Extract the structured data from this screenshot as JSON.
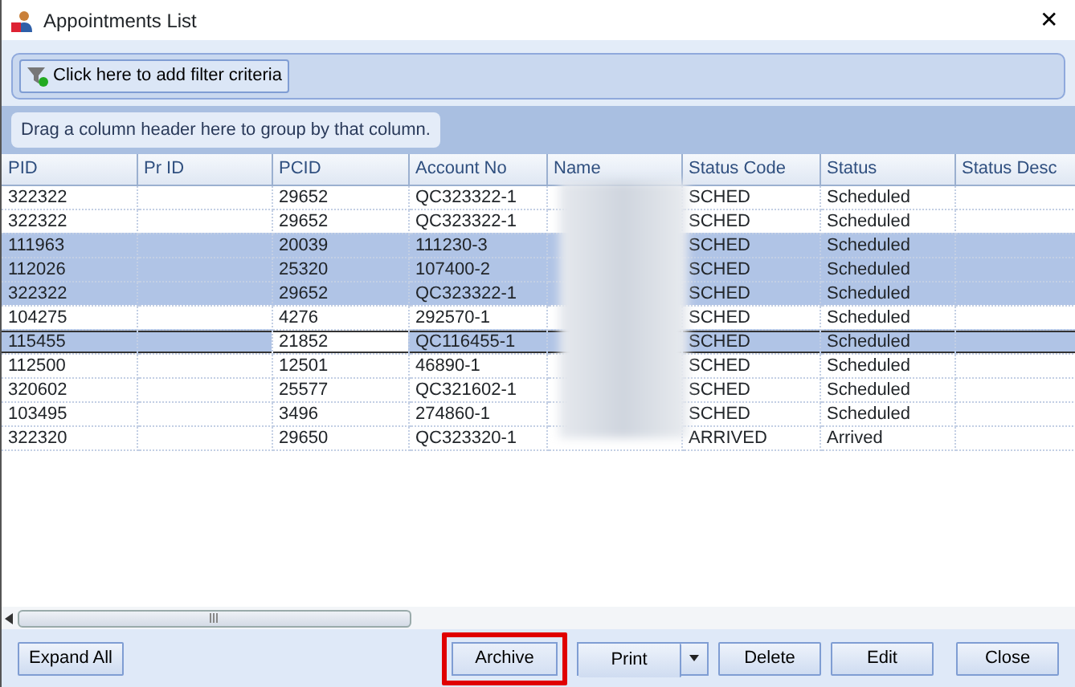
{
  "window": {
    "title": "Appointments List",
    "close": "✕"
  },
  "filter_button": {
    "label": "Click here to add filter criteria"
  },
  "group_panel": {
    "hint": "Drag a column header here to group by that column."
  },
  "table": {
    "columns": [
      "PID",
      "Pr ID",
      "PCID",
      "Account No",
      "Name",
      "Status Code",
      "Status",
      "Status Desc"
    ],
    "rows": [
      {
        "cells": [
          "322322",
          "",
          "29652",
          "QC323322-1",
          "",
          "SCHED",
          "Scheduled",
          ""
        ],
        "selected": false,
        "focused": false
      },
      {
        "cells": [
          "322322",
          "",
          "29652",
          "QC323322-1",
          "",
          "SCHED",
          "Scheduled",
          ""
        ],
        "selected": false,
        "focused": false
      },
      {
        "cells": [
          "111963",
          "",
          "20039",
          "111230-3",
          "",
          "SCHED",
          "Scheduled",
          ""
        ],
        "selected": true,
        "focused": false
      },
      {
        "cells": [
          "112026",
          "",
          "25320",
          "107400-2",
          "",
          "SCHED",
          "Scheduled",
          ""
        ],
        "selected": true,
        "focused": false
      },
      {
        "cells": [
          "322322",
          "",
          "29652",
          "QC323322-1",
          "",
          "SCHED",
          "Scheduled",
          ""
        ],
        "selected": true,
        "focused": false
      },
      {
        "cells": [
          "104275",
          "",
          "4276",
          "292570-1",
          "",
          "SCHED",
          "Scheduled",
          ""
        ],
        "selected": false,
        "focused": false
      },
      {
        "cells": [
          "115455",
          "",
          "21852",
          "QC116455-1",
          "",
          "SCHED",
          "Scheduled",
          ""
        ],
        "selected": true,
        "focused": true
      },
      {
        "cells": [
          "112500",
          "",
          "12501",
          "46890-1",
          "",
          "SCHED",
          "Scheduled",
          ""
        ],
        "selected": false,
        "focused": false
      },
      {
        "cells": [
          "320602",
          "",
          "25577",
          "QC321602-1",
          "",
          "SCHED",
          "Scheduled",
          ""
        ],
        "selected": false,
        "focused": false
      },
      {
        "cells": [
          "103495",
          "",
          "3496",
          "274860-1",
          "",
          "SCHED",
          "Scheduled",
          ""
        ],
        "selected": false,
        "focused": false
      },
      {
        "cells": [
          "322320",
          "",
          "29650",
          "QC323320-1",
          "",
          "ARRIVED",
          "Arrived",
          ""
        ],
        "selected": false,
        "focused": false
      }
    ]
  },
  "buttons": [
    {
      "label": "Expand All",
      "kind": "plain",
      "highlighted": false
    },
    {
      "label": "Archive",
      "kind": "plain",
      "highlighted": true
    },
    {
      "label": "Print",
      "kind": "split",
      "highlighted": false
    },
    {
      "label": "Delete",
      "kind": "plain",
      "highlighted": false
    },
    {
      "label": "Edit",
      "kind": "plain",
      "highlighted": false
    },
    {
      "label": "Close",
      "kind": "plain",
      "highlighted": false
    }
  ]
}
